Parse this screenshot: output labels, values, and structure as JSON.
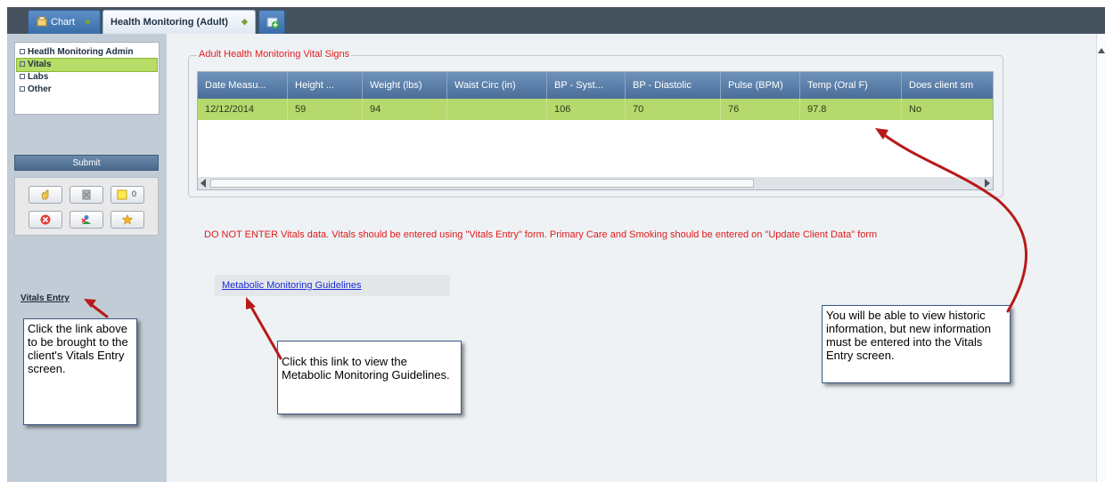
{
  "tabs": [
    {
      "label": "Chart"
    },
    {
      "label": "Health Monitoring (Adult)"
    }
  ],
  "sidebar": {
    "items": [
      {
        "label": "Heatlh Monitoring Admin"
      },
      {
        "label": "Vitals"
      },
      {
        "label": "Labs"
      },
      {
        "label": "Other"
      }
    ],
    "active_item": "Vitals",
    "submit_label": "Submit",
    "notes_count": "0",
    "vitals_entry_link": "Vitals Entry"
  },
  "vital_signs": {
    "legend": "Adult Health Monitoring Vital Signs",
    "columns": [
      "Date Measu...",
      "Height ...",
      "Weight (lbs)",
      "Waist Circ (in)",
      "BP - Syst...",
      "BP - Diastolic",
      "Pulse (BPM)",
      "Temp (Oral F)",
      "Does client sm"
    ],
    "rows": [
      [
        "12/12/2014",
        "59",
        "94",
        "",
        "106",
        "70",
        "76",
        "97.8",
        "No"
      ]
    ],
    "horizontal_scroll_fraction": 0.69
  },
  "warning_text": "DO NOT ENTER Vitals data. Vitals should be entered using \"Vitals Entry\" form. Primary Care and Smoking should be entered on \"Update Client Data\" form",
  "metabolic_link": "Metabolic Monitoring Guidelines",
  "callouts": {
    "vitals_entry": "Click the link above to be brought to the client's Vitals Entry screen.",
    "metabolic": "Click this link to view the Metabolic Monitoring Guidelines.",
    "historic": "You will be able to view historic information, but new information must be entered into the Vitals Entry screen."
  },
  "colors": {
    "header_bar": "#46525e",
    "sidebar": "#c2ccd6",
    "active_row": "#b5d96c",
    "grid_header": "#5a7fa9",
    "warning": "#e01a1a",
    "arrow": "#b81a1a"
  },
  "icons": {
    "chart_tab": "chart-folder-icon",
    "add_tab": "add-tab-icon",
    "toolbar": [
      "hand-icon",
      "delete-grey-icon",
      "note-icon",
      "cancel-icon",
      "user-remove-icon",
      "star-icon"
    ]
  }
}
